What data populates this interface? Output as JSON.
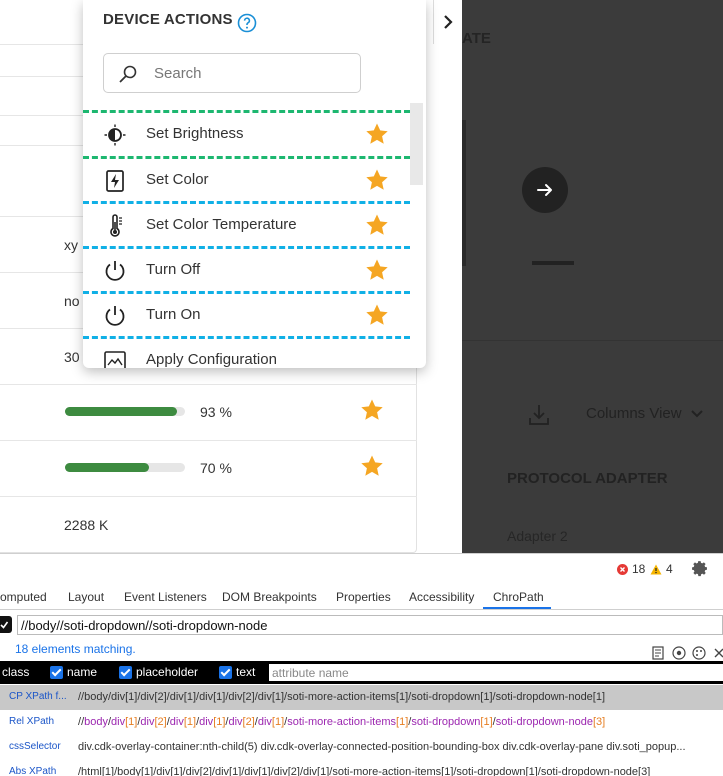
{
  "table": {
    "rows": [
      {
        "type": "text",
        "value": "xy"
      },
      {
        "type": "text",
        "value": "no"
      },
      {
        "type": "text",
        "value": "30"
      },
      {
        "type": "progress",
        "value": 93,
        "label": "93 %",
        "starred": true
      },
      {
        "type": "progress",
        "value": 70,
        "label": "70 %",
        "starred": true
      },
      {
        "type": "text",
        "value": "2288 K"
      }
    ]
  },
  "right_panel": {
    "partial_title": "ATE",
    "columns_view": "Columns View",
    "section_title": "PROTOCOL ADAPTER",
    "adapter_label": "Adapter 2"
  },
  "dropdown": {
    "title": "DEVICE ACTIONS",
    "search_placeholder": "Search",
    "items": [
      {
        "label": "Set Brightness",
        "icon": "brightness-icon",
        "favorite": true
      },
      {
        "label": "Set Color",
        "icon": "flash-icon",
        "favorite": true
      },
      {
        "label": "Set Color Temperature",
        "icon": "thermometer-icon",
        "favorite": true
      },
      {
        "label": "Turn Off",
        "icon": "power-icon",
        "favorite": true
      },
      {
        "label": "Turn On",
        "icon": "power-icon",
        "favorite": true
      },
      {
        "label": "Apply Configuration",
        "icon": "configuration-icon",
        "favorite": false
      }
    ],
    "colors": {
      "star": "#f5a623",
      "selected_outline": "#1db770",
      "match_outline": "#10b0e6"
    }
  },
  "devtools": {
    "errors": "18",
    "warnings": "4",
    "tabs": [
      "omputed",
      "Layout",
      "Event Listeners",
      "DOM Breakpoints",
      "Properties",
      "Accessibility",
      "ChroPath"
    ],
    "active_tab": "ChroPath",
    "xpath_query": "//body//soti-dropdown//soti-dropdown-node",
    "match_text": "18 elements matching.",
    "attr_options": [
      "class",
      "name",
      "placeholder",
      "text"
    ],
    "attr_placeholder": "attribute name",
    "locators": [
      {
        "key": "CP XPath f...",
        "value": "//body/div[1]/div[2]/div[1]/div[1]/div[2]/div[1]/soti-more-action-items[1]/soti-dropdown[1]/soti-dropdown-node[1]"
      },
      {
        "key": "Rel XPath",
        "value": "//body/div[1]/div[2]/div[1]/div[1]/div[2]/div[1]/soti-more-action-items[1]/soti-dropdown[1]/soti-dropdown-node[3]"
      },
      {
        "key": "cssSelector",
        "value": "div.cdk-overlay-container:nth-child(5) div.cdk-overlay-connected-position-bounding-box div.cdk-overlay-pane div.soti_popup..."
      },
      {
        "key": "Abs XPath",
        "value": "/html[1]/body[1]/div[1]/div[2]/div[1]/div[1]/div[2]/div[1]/soti-more-action-items[1]/soti-dropdown[1]/soti-dropdown-node[3]"
      }
    ]
  }
}
